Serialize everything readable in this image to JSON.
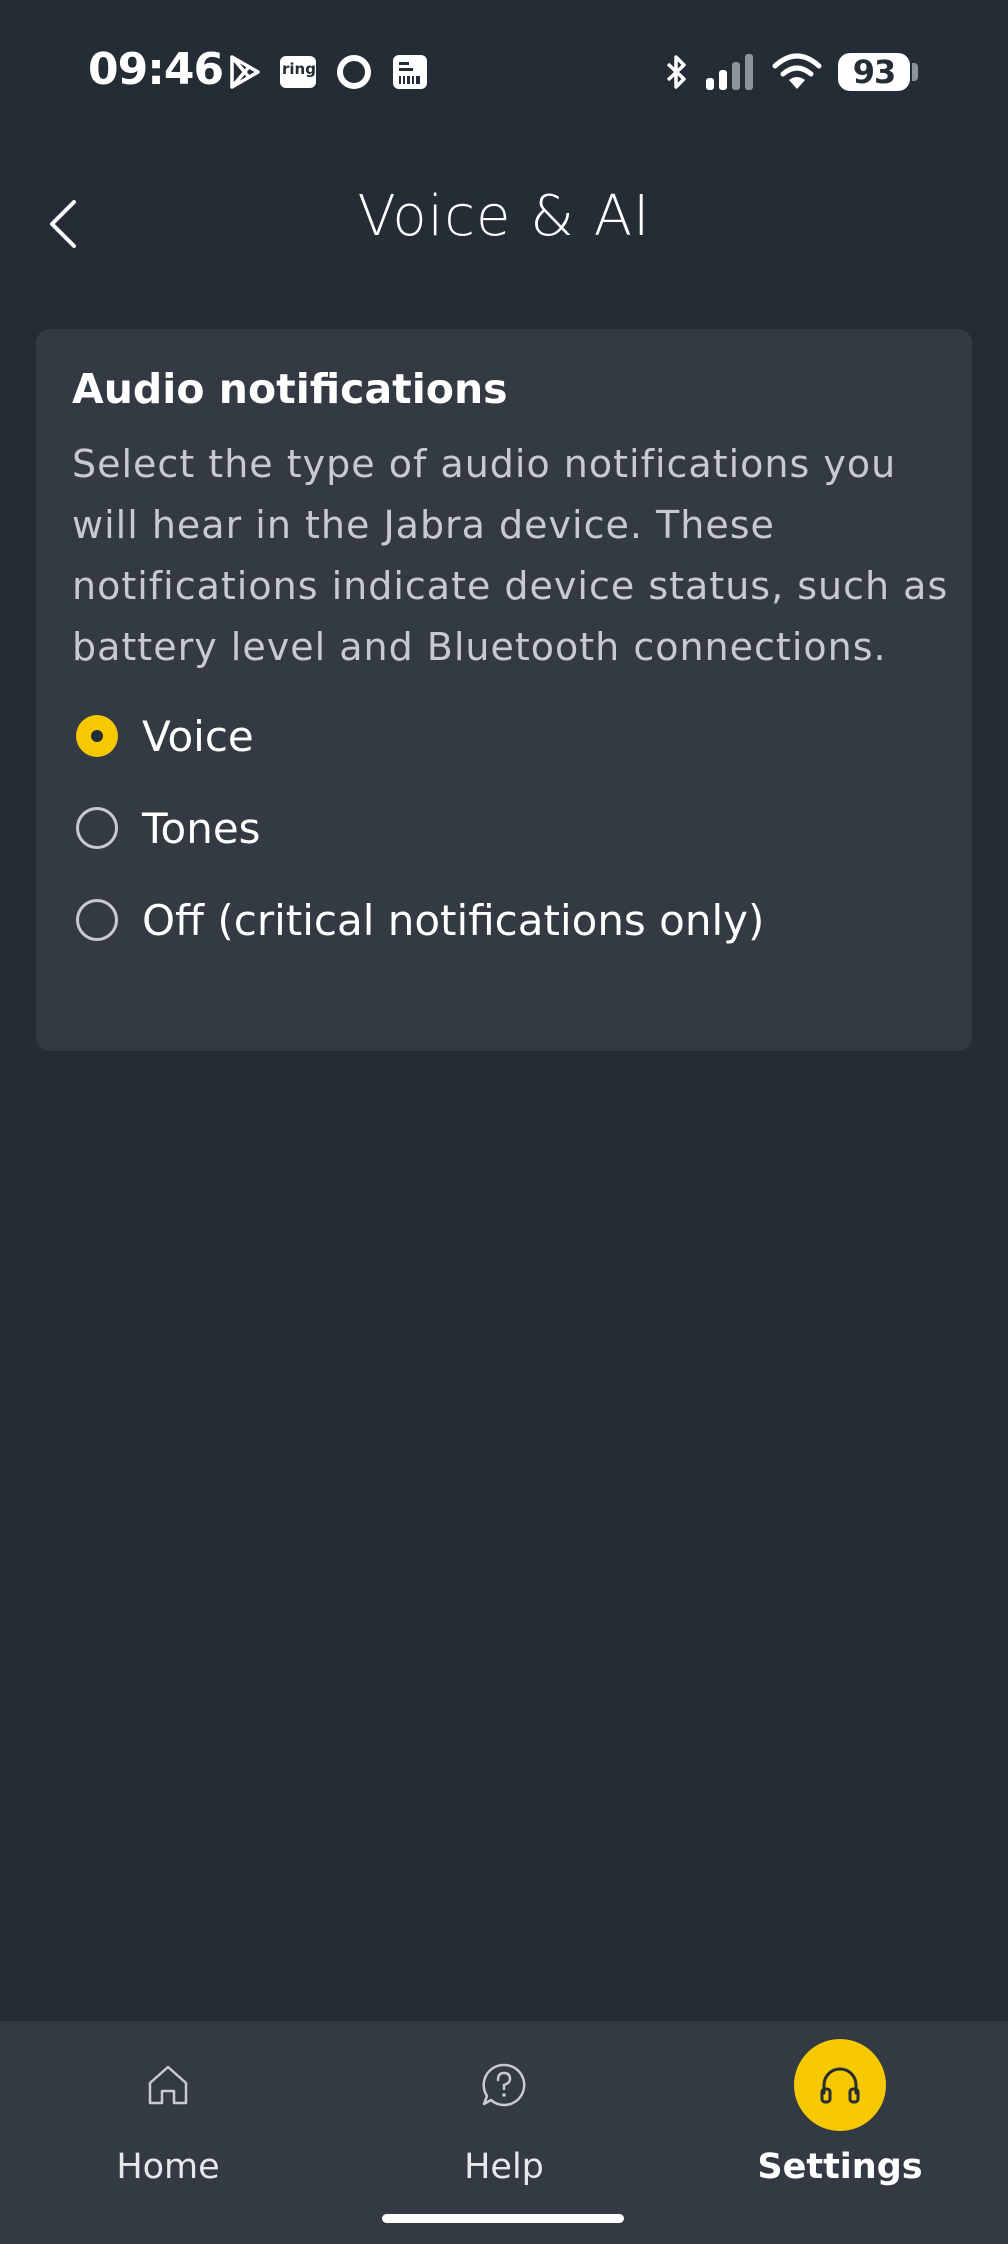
{
  "status_bar": {
    "time": "09:46",
    "battery_level": "93",
    "notification_icons": [
      "play-store-icon",
      "ring-icon",
      "circle-app-icon",
      "receipt-icon"
    ],
    "system_icons": [
      "bluetooth-icon",
      "cell-signal-icon",
      "wifi-icon",
      "battery-icon"
    ],
    "ring_label": "ring"
  },
  "header": {
    "title": "Voice & AI",
    "back_icon": "chevron-left-icon"
  },
  "audio_notifications": {
    "title": "Audio notifications",
    "description": "Select the type of audio notifications you will hear in the Jabra device. These notifications indicate device status, such as battery level and Bluetooth connections.",
    "options": [
      {
        "label": "Voice",
        "selected": true
      },
      {
        "label": "Tones",
        "selected": false
      },
      {
        "label": "Off (critical notifications only)",
        "selected": false
      }
    ]
  },
  "bottom_nav": {
    "items": [
      {
        "label": "Home",
        "icon": "home-icon",
        "active": false
      },
      {
        "label": "Help",
        "icon": "help-icon",
        "active": false
      },
      {
        "label": "Settings",
        "icon": "headphones-icon",
        "active": true
      }
    ]
  },
  "colors": {
    "background": "#242c35",
    "card": "#333a43",
    "accent": "#f6c800",
    "text_secondary": "#c7cbd0"
  }
}
